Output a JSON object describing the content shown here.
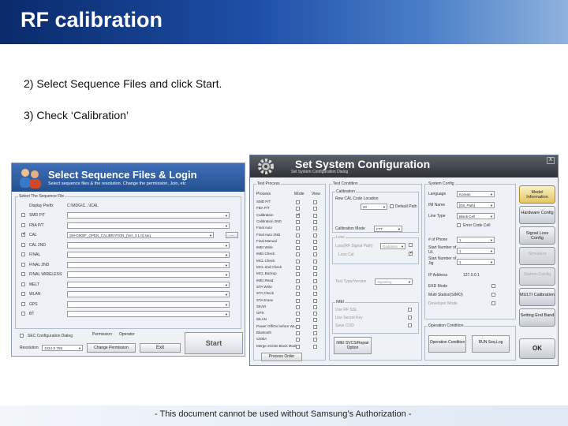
{
  "slide": {
    "title": "RF calibration",
    "step2": "2) Select Sequence Files and click Start.",
    "step3": "3) Check ‘Calibration’",
    "footer": "- This document cannot be used without Samsung’s Authorization -"
  },
  "seq": {
    "title": "Select Sequence Files & Login",
    "subtitle": "Select sequence files & the resolution. Change the permission, Join, etc",
    "group_label": "Select The Sequence File",
    "display_prefix_label": "Display Prefix",
    "display_prefix_value": "C:\\MDG\\C...\\ICAL",
    "files": [
      {
        "label": "SMD P/T",
        "checked": false,
        "value": ""
      },
      {
        "label": "FBA P/T",
        "checked": false,
        "value": ""
      },
      {
        "label": "CAL",
        "checked": true,
        "value": "SM-G900F_OPEN_CALIBRATION_(Ver_3.1.0).seq"
      },
      {
        "label": "CAL 2ND",
        "checked": false,
        "value": ""
      },
      {
        "label": "FINAL",
        "checked": false,
        "value": ""
      },
      {
        "label": "FINAL 2ND",
        "checked": false,
        "value": ""
      },
      {
        "label": "FINAL WIRELESS",
        "checked": false,
        "value": ""
      },
      {
        "label": "MELT",
        "checked": false,
        "value": ""
      },
      {
        "label": "WLAN",
        "checked": false,
        "value": ""
      },
      {
        "label": "GPS",
        "checked": false,
        "value": ""
      },
      {
        "label": "BT",
        "checked": false,
        "value": ""
      }
    ],
    "browse_label": "...",
    "sec_config_label": "SEC Configuration Dialog",
    "permission_label": "Permission",
    "permission_value": "Operator",
    "resolution_label": "Resolution",
    "resolution_value": "1024 X 768",
    "change_permission": "Change Permission",
    "exit": "Exit",
    "start": "Start"
  },
  "cfg": {
    "title": "Set System Configuration",
    "subtitle": "Set System Configuration Dialog",
    "close": "X",
    "test_process_label": "Test Process",
    "col_process": "Process",
    "col_mode": "Mode",
    "col_view": "View",
    "processes": [
      {
        "name": "SMD P/T",
        "mode": false,
        "view": false
      },
      {
        "name": "FBA P/T",
        "mode": false,
        "view": false
      },
      {
        "name": "Calibration",
        "mode": true,
        "view": false
      },
      {
        "name": "Calibration 2ND",
        "mode": false,
        "view": false
      },
      {
        "name": "Final Auto",
        "mode": false,
        "view": false
      },
      {
        "name": "Final Auto 2ND",
        "mode": false,
        "view": false
      },
      {
        "name": "Final Manual",
        "mode": false,
        "view": false
      },
      {
        "name": "IMEI Write",
        "mode": false,
        "view": false
      },
      {
        "name": "IMEI Check",
        "mode": false,
        "view": false
      },
      {
        "name": "MCL Check",
        "mode": false,
        "view": false
      },
      {
        "name": "MCL 2nd Check",
        "mode": false,
        "view": false
      },
      {
        "name": "MCL Backup",
        "mode": false,
        "view": false
      },
      {
        "name": "IMEI Read",
        "mode": false,
        "view": false
      },
      {
        "name": "STA Write",
        "mode": false,
        "view": false
      },
      {
        "name": "STA Check",
        "mode": false,
        "view": false
      },
      {
        "name": "STA Erase",
        "mode": false,
        "view": false
      },
      {
        "name": "SEAR",
        "mode": false,
        "view": false
      },
      {
        "name": "GPS",
        "mode": false,
        "view": false
      },
      {
        "name": "WLAN",
        "mode": false,
        "view": false
      },
      {
        "name": "Power Off/On before WLAN",
        "mode": false,
        "view": false
      },
      {
        "name": "Bluetooth",
        "mode": false,
        "view": false
      },
      {
        "name": "CDMA",
        "mode": false,
        "view": false
      },
      {
        "name": "Merge 2G/3G Block Mode",
        "mode": false,
        "view": false
      }
    ],
    "process_order": "Process Order",
    "test_condition_label": "Test Condition",
    "calibration_group": "Calibration",
    "rew_cal_label": "Rew CAL Code Location",
    "rew_cal_value": "20",
    "default_path": "Default Path",
    "cal_mode_label": "Calibration Mode",
    "cal_mode_value": "FTT",
    "loss_group": "Loss",
    "loss_label": "Loss(RF Signal Path)",
    "loss_value": "Radiation",
    "loss_cal": "Loss Cal",
    "test_type_label": "Test Type/Version",
    "test_type_value": "Signaling",
    "imei_group": "IMEI",
    "use_rf_ssl": "Use RF SSL",
    "use_secret_key": "Use Secret Key",
    "save_cod": "Save COD",
    "system_config_label": "System Config",
    "language_label": "Language",
    "language_value": "Korean",
    "ini_name_label": "INI Name",
    "ini_name_value": "[INI_Path]",
    "line_type_label": "Line Type",
    "line_type_value": "Black Cell",
    "error_code_cell": "Error Code Cell",
    "num_phone_label": "# of Phone",
    "num_phone_value": "1",
    "start_num_ul_label": "Start Number of UL",
    "start_num_ul_value": "1",
    "start_num_jig_label": "Start Number of Jig",
    "start_num_jig_value": "1",
    "ip_label": "IP Address",
    "ip_value": "127.0.0.1",
    "ekd_mode": "EKD Mode",
    "multi_station": "Multi Station(SIMO)",
    "developer_mode": "Developer Mode",
    "operation_condition_label": "Operation Condition",
    "op_condition_btn": "Operation Condition",
    "run_seq_btn": "RUN Seq.Log",
    "imei_svcs_btn": "IMEI SVCS/Repair Option",
    "side_buttons": [
      "Model Information",
      "Hardware Config",
      "Signal Loss Config",
      "Simulator",
      "Station Config",
      "MULTI Calibration",
      "Setting End Band"
    ],
    "ok": "OK"
  }
}
